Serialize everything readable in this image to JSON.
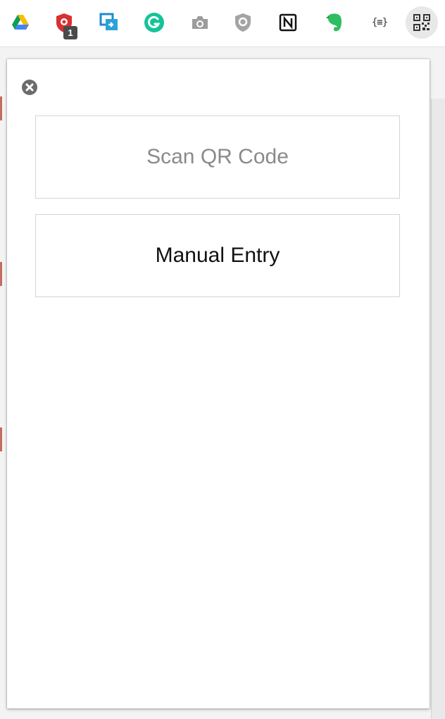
{
  "toolbar": {
    "extensions": [
      {
        "icon": "google-drive-icon"
      },
      {
        "icon": "shield-extension-icon",
        "badge": "1"
      },
      {
        "icon": "screen-share-icon"
      },
      {
        "icon": "grammarly-icon"
      },
      {
        "icon": "camera-icon"
      },
      {
        "icon": "guard-shield-icon"
      },
      {
        "icon": "notion-icon"
      },
      {
        "icon": "evernote-icon"
      },
      {
        "icon": "json-formatter-icon",
        "glyph": "{≡}"
      },
      {
        "icon": "qr-code-icon",
        "active": true
      }
    ]
  },
  "popup": {
    "close_icon": "close-icon",
    "scan_label": "Scan QR Code",
    "manual_label": "Manual Entry"
  },
  "colors": {
    "scan_text": "#8a8a8a",
    "manual_text": "#111111",
    "border": "#d4d4d4",
    "badge_bg": "#4a4a4a"
  }
}
